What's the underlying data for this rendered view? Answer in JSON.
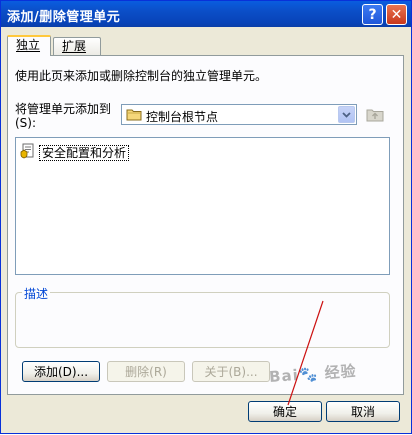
{
  "window": {
    "title": "添加/删除管理单元"
  },
  "title_buttons": {
    "help": "?",
    "close": "✕"
  },
  "tabs": [
    {
      "label": "独立",
      "active": true
    },
    {
      "label": "扩展",
      "active": false
    }
  ],
  "instruction": "使用此页来添加或删除控制台的独立管理单元。",
  "add_to": {
    "label": "将管理单元添加到(S):",
    "value": "控制台根节点"
  },
  "snapins": [
    {
      "label": "安全配置和分析"
    }
  ],
  "description_group": {
    "title": "描述"
  },
  "buttons": {
    "add": "添加(D)...",
    "remove": "删除(R)",
    "about": "关于(B)...",
    "ok": "确定",
    "cancel": "取消"
  },
  "watermark": "Bai🐾 经验",
  "colors": {
    "title_bar": "#0a5ddf",
    "dialog_bg": "#ece9d8",
    "panel_bg": "#fcfcfe",
    "group_title": "#0046d5",
    "annotation_line": "#cc1111"
  },
  "icons": {
    "combo_icon": "folder-icon",
    "snapin_icon": "snapin-icon",
    "up_icon": "folder-up-icon",
    "arrow_icon": "chevron-down-icon"
  }
}
